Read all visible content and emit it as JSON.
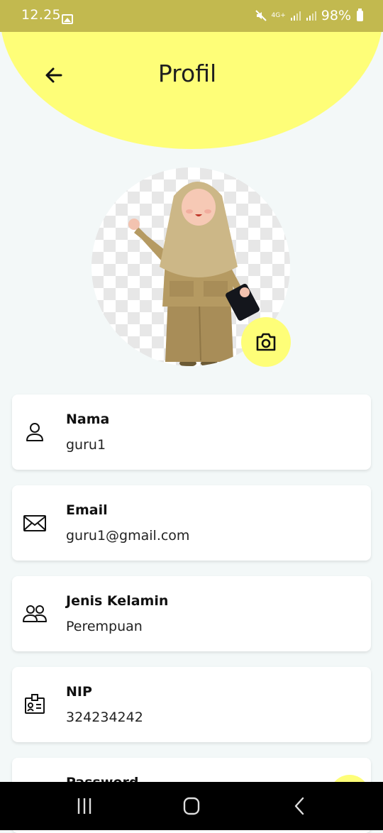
{
  "status_bar": {
    "time": "12.25",
    "network": "4G+",
    "battery": "98%"
  },
  "header": {
    "title": "Profil"
  },
  "profile": {
    "avatar_icon": "teacher-avatar-illustration",
    "camera_icon": "camera-icon"
  },
  "fields": [
    {
      "label": "Nama",
      "value": "guru1",
      "icon": "person-icon"
    },
    {
      "label": "Email",
      "value": "guru1@gmail.com",
      "icon": "envelope-icon"
    },
    {
      "label": "Jenis Kelamin",
      "value": "Perempuan",
      "icon": "people-icon"
    },
    {
      "label": "NIP",
      "value": "324234242",
      "icon": "id-badge-icon"
    },
    {
      "label": "Password",
      "value": "",
      "icon": "lock-icon"
    }
  ],
  "colors": {
    "accent": "#fefe78",
    "status_bar": "#c2b94f",
    "background": "#f3f8f8"
  }
}
